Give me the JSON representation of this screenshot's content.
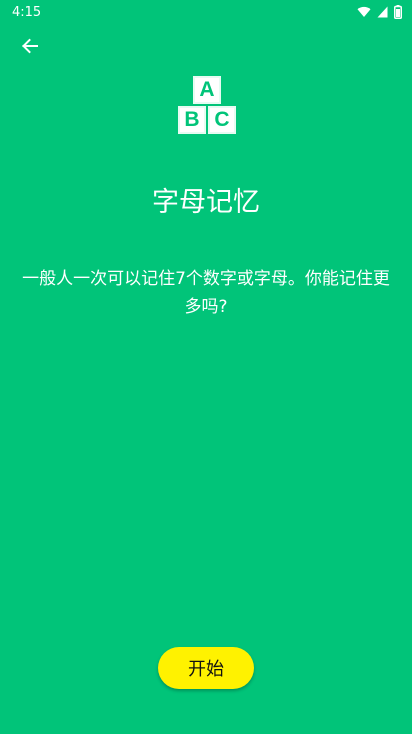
{
  "status_bar": {
    "time": "4:15",
    "icons": [
      "wifi-icon",
      "signal-icon",
      "battery-icon"
    ]
  },
  "toolbar": {
    "back_icon": "arrow-left-icon"
  },
  "logo": {
    "letters": [
      "A",
      "B",
      "C"
    ]
  },
  "content": {
    "title": "字母记忆",
    "description": "一般人一次可以记住7个数字或字母。你能记住更多吗?"
  },
  "actions": {
    "start_label": "开始"
  },
  "colors": {
    "background": "#01C479",
    "button": "#FFF200",
    "text": "#FFFFFF"
  }
}
